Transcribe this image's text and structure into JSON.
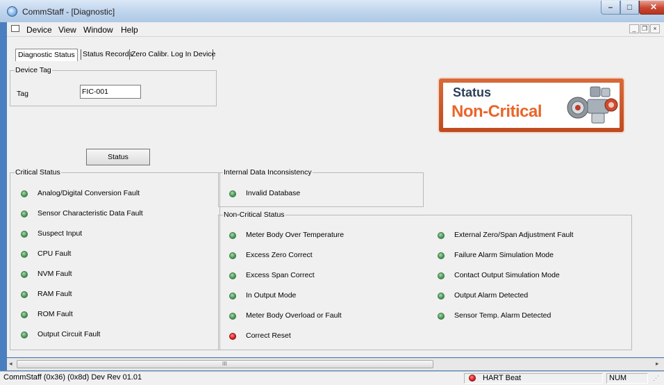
{
  "window": {
    "title": "CommStaff - [Diagnostic]"
  },
  "menu": {
    "items": [
      "Device",
      "View",
      "Window",
      "Help"
    ]
  },
  "tabs": [
    {
      "label": "Diagnostic Status",
      "active": true
    },
    {
      "label": "Status Records",
      "active": false
    },
    {
      "label": "Zero Calibr. Log In Device",
      "active": false
    }
  ],
  "device_tag": {
    "group_title": "Device Tag",
    "label": "Tag",
    "value": "FIC-001"
  },
  "status_button": {
    "label": "Status"
  },
  "status_graphic": {
    "title": "Status",
    "value": "Non-Critical",
    "color": "#e8662a"
  },
  "critical_status": {
    "title": "Critical Status",
    "items": [
      {
        "label": "Analog/Digital Conversion Fault",
        "state": "green"
      },
      {
        "label": "Sensor Characteristic Data Fault",
        "state": "green"
      },
      {
        "label": "Suspect Input",
        "state": "green"
      },
      {
        "label": "CPU Fault",
        "state": "green"
      },
      {
        "label": "NVM Fault",
        "state": "green"
      },
      {
        "label": "RAM Fault",
        "state": "green"
      },
      {
        "label": "ROM Fault",
        "state": "green"
      },
      {
        "label": "Output Circuit Fault",
        "state": "green"
      }
    ]
  },
  "internal_data": {
    "title": "Internal Data Inconsistency",
    "items": [
      {
        "label": "Invalid Database",
        "state": "green"
      }
    ]
  },
  "non_critical_status": {
    "title": "Non-Critical Status",
    "col1": [
      {
        "label": "Meter Body Over Temperature",
        "state": "green"
      },
      {
        "label": "Excess Zero Correct",
        "state": "green"
      },
      {
        "label": "Excess Span Correct",
        "state": "green"
      },
      {
        "label": "In Output Mode",
        "state": "green"
      },
      {
        "label": "Meter Body Overload or Fault",
        "state": "green"
      },
      {
        "label": "Correct Reset",
        "state": "red"
      }
    ],
    "col2": [
      {
        "label": "External Zero/Span Adjustment Fault",
        "state": "green"
      },
      {
        "label": "Failure Alarm Simulation Mode",
        "state": "green"
      },
      {
        "label": "Contact Output Simulation Mode",
        "state": "green"
      },
      {
        "label": "Output Alarm Detected",
        "state": "green"
      },
      {
        "label": "Sensor Temp. Alarm Detected",
        "state": "green"
      }
    ]
  },
  "scrollbar": {
    "grip": "III"
  },
  "statusbar": {
    "info": "CommStaff  (0x36) (0x8d) Dev Rev 01.01",
    "heartbeat": "HART Beat",
    "num": "NUM"
  }
}
